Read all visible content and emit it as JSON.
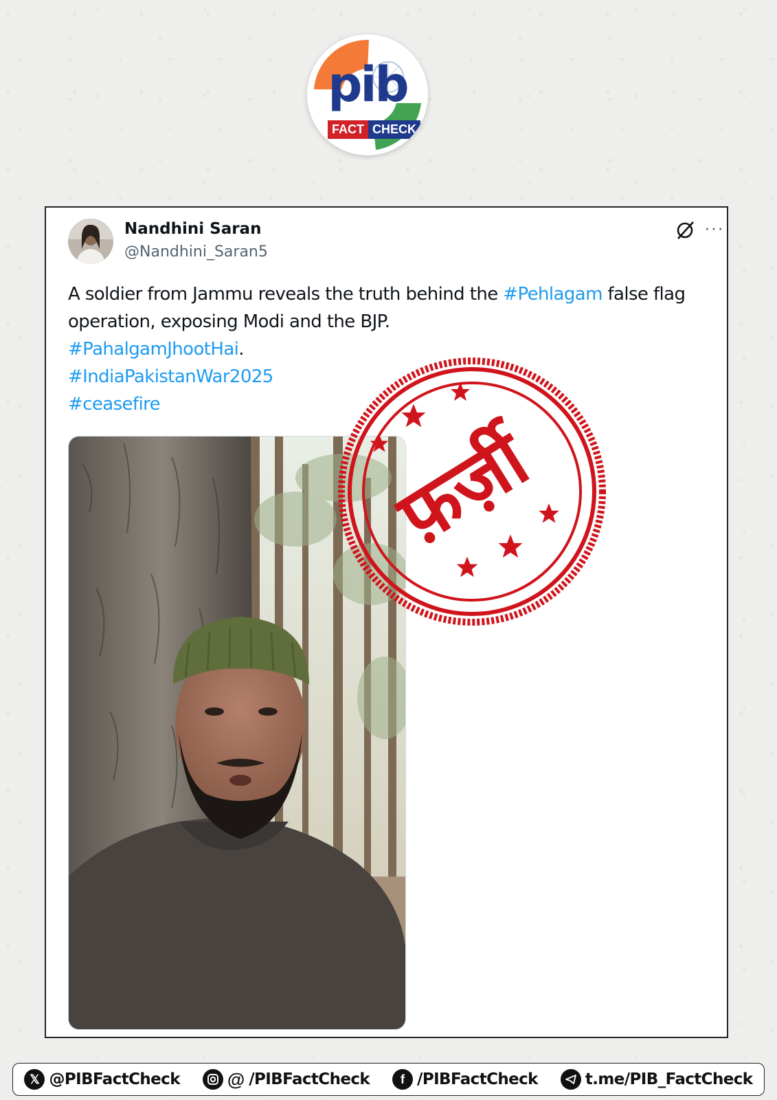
{
  "logo": {
    "brand": "pib",
    "fact": "FACT",
    "check": "CHECK"
  },
  "tweet": {
    "display_name": "Nandhini Saran",
    "handle": "@Nandhini_Saran5",
    "text_part1": "A soldier from Jammu reveals the truth behind the ",
    "hashtag_pehlagam": "#Pehlagam",
    "text_part2": " false flag",
    "text_line2": "operation, exposing Modi and the BJP.",
    "hashtag_jhoot": "#PahalgamJhootHai",
    "hashtag_jhoot_suffix": ".",
    "hashtag_war": "#IndiaPakistanWar2025",
    "hashtag_ceasefire": "#ceasefire",
    "more_label": "···"
  },
  "stamp": {
    "label": "फ़र्ज़ी",
    "color": "#d0141c"
  },
  "footer": {
    "x_handle": "@PIBFactCheck",
    "insta_threads_handle": "/PIBFactCheck",
    "facebook_handle": "/PIBFactCheck",
    "telegram_link": "t.me/PIB_FactCheck"
  },
  "colors": {
    "hashtag": "#1d9bf0",
    "pib_blue": "#1f3a8c",
    "pib_red": "#d12129",
    "saffron": "#f26b21",
    "green": "#2e9a3f"
  }
}
